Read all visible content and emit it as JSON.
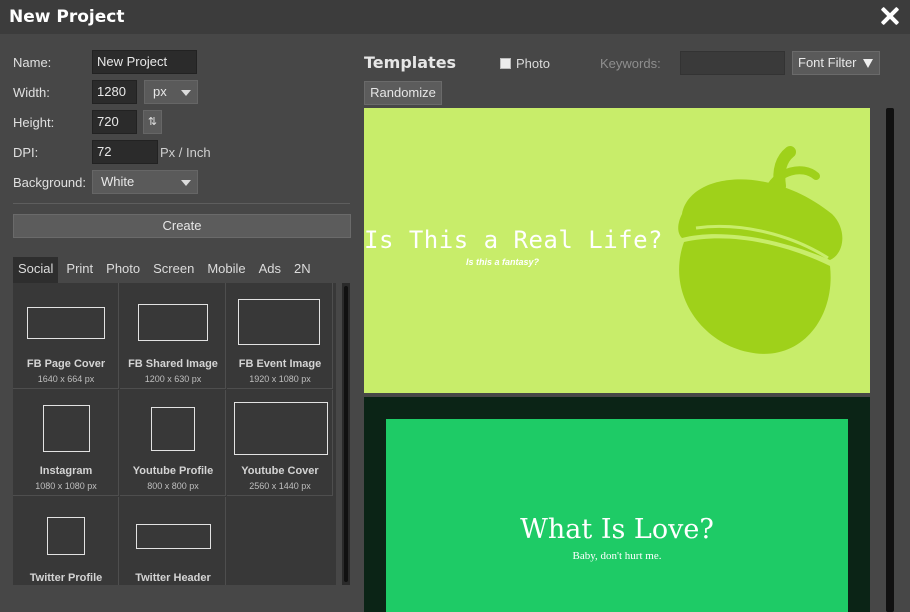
{
  "window": {
    "title": "New Project",
    "close_icon": "close-icon"
  },
  "form": {
    "name_label": "Name:",
    "name_value": "New Project",
    "width_label": "Width:",
    "width_value": "1280",
    "unit_select": "px",
    "height_label": "Height:",
    "height_value": "720",
    "swap_glyph": "⇅",
    "dpi_label": "DPI:",
    "dpi_value": "72",
    "dpi_unit": "Px / Inch",
    "background_label": "Background:",
    "background_select": "White",
    "create_label": "Create"
  },
  "preset_tabs": [
    "Social",
    "Print",
    "Photo",
    "Screen",
    "Mobile",
    "Ads",
    "2N"
  ],
  "presets": [
    {
      "name": "FB Page Cover",
      "size": "1640 x 664 px"
    },
    {
      "name": "FB Shared Image",
      "size": "1200 x 630 px"
    },
    {
      "name": "FB Event Image",
      "size": "1920 x 1080 px"
    },
    {
      "name": "Instagram",
      "size": "1080 x 1080 px"
    },
    {
      "name": "Youtube Profile",
      "size": "800 x 800 px"
    },
    {
      "name": "Youtube Cover",
      "size": "2560 x 1440 px"
    },
    {
      "name": "Twitter Profile",
      "size": ""
    },
    {
      "name": "Twitter Header",
      "size": ""
    }
  ],
  "templates_panel": {
    "title": "Templates",
    "photo_label": "Photo",
    "keywords_label": "Keywords:",
    "keywords_value": "",
    "font_filter_label": "Font Filter",
    "randomize_label": "Randomize"
  },
  "templates": [
    {
      "heading": "Is This a Real Life?",
      "subheading": "Is this a fantasy?",
      "bg": "#c8ed6a",
      "accent": "#9fd11a"
    },
    {
      "heading": "What Is Love?",
      "subheading": "Baby, don't hurt me.",
      "bg": "#0b2416",
      "accent": "#1ecb66"
    }
  ],
  "colors": {
    "dialog_bg": "#474747",
    "titlebar_bg": "#3c3c3c",
    "field_bg": "#2b2b2b"
  }
}
